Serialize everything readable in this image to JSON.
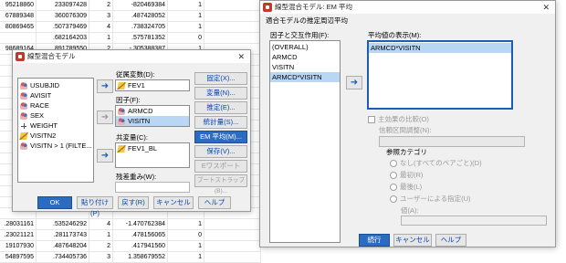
{
  "sheet": {
    "rows": [
      [
        "95218860",
        "233097428",
        "2",
        "-820469384",
        "1"
      ],
      [
        "67889348",
        "360076309",
        "3",
        ".487428052",
        "1"
      ],
      [
        "80869465",
        ".507379469",
        "4",
        ".738324705",
        "1"
      ],
      [
        "",
        ".682164203",
        "1",
        ".575781352",
        "0"
      ],
      [
        "98689164",
        ".891789550",
        "2",
        "-.305388387",
        "1"
      ],
      [
        "",
        "",
        "",
        "",
        ""
      ],
      [
        "",
        "",
        "",
        "",
        ""
      ],
      [
        "",
        "",
        "",
        "",
        ""
      ],
      [
        "",
        "",
        "",
        "",
        ""
      ],
      [
        "",
        "",
        "",
        "",
        ""
      ],
      [
        "",
        "",
        "",
        "",
        ""
      ],
      [
        "",
        "",
        "",
        "",
        ""
      ],
      [
        "",
        "",
        "",
        "",
        ""
      ],
      [
        "",
        "",
        "",
        "",
        ""
      ],
      [
        "",
        "",
        "",
        "",
        ""
      ],
      [
        "",
        "",
        "",
        "",
        ""
      ],
      [
        "",
        "",
        "",
        "",
        ""
      ],
      [
        ".93",
        "",
        "",
        "",
        ""
      ],
      [
        ".93",
        "",
        "",
        "",
        ""
      ],
      [
        "",
        "",
        "",
        "",
        ""
      ],
      [
        ".28031161",
        ".535246292",
        "4",
        "-1.470762384",
        "1"
      ],
      [
        ".23021121",
        ".281173743",
        "1",
        ".478156065",
        "0"
      ],
      [
        "19107930",
        ".487648204",
        "2",
        ".417941560",
        "1"
      ],
      [
        "54897595",
        ".734405736",
        "3",
        "1.358679552",
        "1"
      ]
    ]
  },
  "dialog_left": {
    "title": "線型混合モデル",
    "variable_list": [
      {
        "icon": "people-icon",
        "label": "USUBJID"
      },
      {
        "icon": "people-icon",
        "label": "AVISIT"
      },
      {
        "icon": "people-icon",
        "label": "RACE"
      },
      {
        "icon": "people-icon",
        "label": "SEX"
      },
      {
        "icon": "scale-icon",
        "label": "WEIGHT"
      },
      {
        "icon": "pencil-icon",
        "label": "VISITN2"
      },
      {
        "icon": "people-icon",
        "label": "VISITN > 1 (FILTE..."
      }
    ],
    "dependent_label": "従属変数(D):",
    "dependent_value": "FEV1",
    "factors_label": "因子(F):",
    "factors": [
      "ARMCD",
      "VISITN"
    ],
    "covariates_label": "共変量(C):",
    "covariate_value": "FEV1_BL",
    "residual_weight_label": "残差重み(W):",
    "side_buttons": [
      "固定(X)...",
      "変量(N)...",
      "推定(E)...",
      "統計量(S)...",
      "EM 平均(M)...",
      "保存(V)...",
      "Eワスポート",
      "ブートストラップ(B)..."
    ],
    "bottom_buttons": [
      "OK",
      "貼り付け(P)",
      "戻す(R)",
      "キャンセル",
      "ヘルプ"
    ]
  },
  "dialog_right": {
    "title": "線型混合モデル: EM 平均",
    "group_label": "適合モデルの推定周辺平均",
    "factors_label": "因子と交互作用(F):",
    "factors": [
      "(OVERALL)",
      "ARMCD",
      "VISITN",
      "ARMCD*VISITN"
    ],
    "display_label": "平均値の表示(M):",
    "display_items": [
      "ARMCD*VISITN"
    ],
    "compare_label": "主効果の比較(O)",
    "ci_label": "信頼区間調整(N):",
    "reference_label": "参照カテゴリ",
    "radio_options": [
      "なし(すべてのペアごと)(D)",
      "最初(R)",
      "最後(L)",
      "ユーザーによる指定(U)"
    ],
    "value_label": "値(A):",
    "bottom_buttons": [
      "続行",
      "キャンセル",
      "ヘルプ"
    ]
  }
}
